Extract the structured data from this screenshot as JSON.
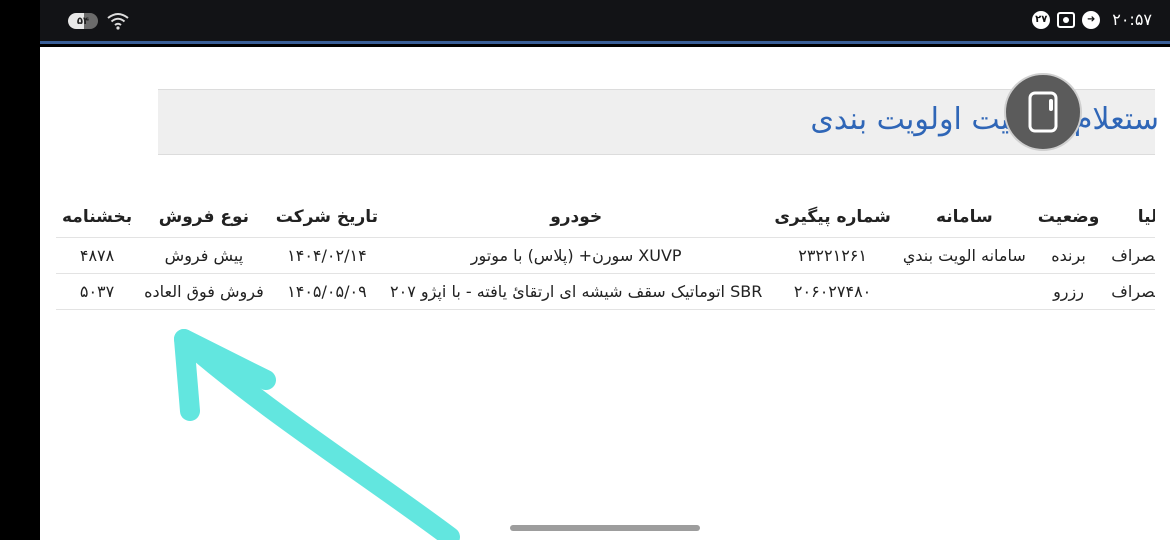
{
  "status": {
    "battery": "۵۴",
    "battery_level": 0.54,
    "time": "۲۰:۵۷",
    "notif_count": "۲۷"
  },
  "page": {
    "title": "ستعلام وضعیت اولویت بندی"
  },
  "table": {
    "headers": [
      "بخشنامه",
      "نوع فروش",
      "تاریخ شرکت",
      "خودرو",
      "شماره پیگیری",
      "سامانه",
      "وضعیت",
      "عملیا"
    ],
    "rows": [
      [
        "۴۸۷۸",
        "پیش فروش",
        "۱۴۰۴/۰۲/۱۴",
        "سورن+ (پلاس) با موتور XUVP",
        "۲۳۲۲۱۲۶۱",
        "سامانه الويت بندي",
        "برنده",
        "امکان انصراف"
      ],
      [
        "۵۰۳۷",
        "فروش فوق العاده",
        "۱۴۰۵/۰۵/۰۹",
        "پژو ۲۰۷i اتوماتیک سقف شیشه ای ارتقائ یافته - با SBR",
        "۲۰۶۰۲۷۴۸۰",
        "",
        "رزرو",
        "امکان انصراف"
      ]
    ]
  },
  "colors": {
    "title": "#2f66b7",
    "arrow": "#62e6df"
  }
}
